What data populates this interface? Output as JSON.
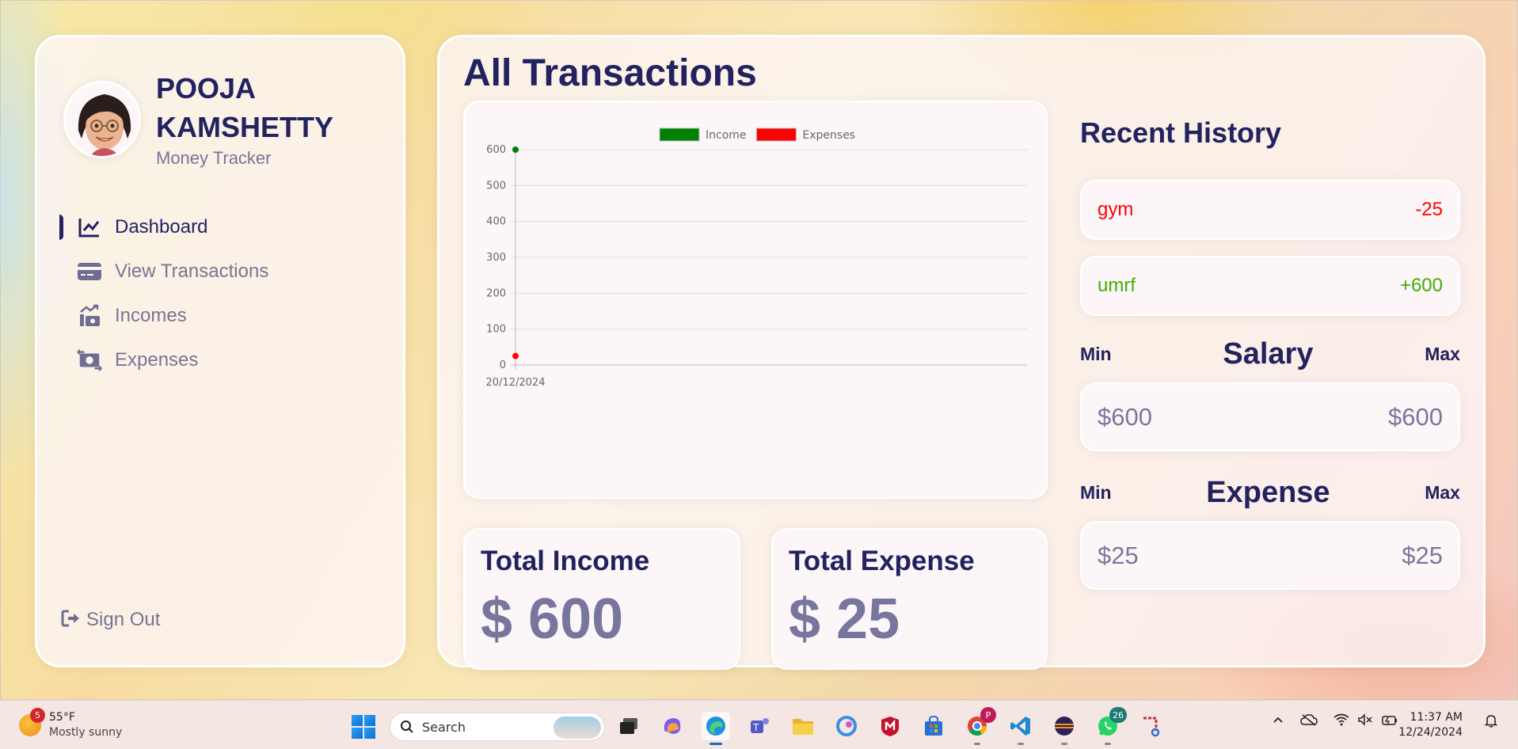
{
  "user": {
    "name": "POOJA KAMSHETTY",
    "subtitle": "Money Tracker"
  },
  "menu": [
    {
      "label": "Dashboard",
      "icon": "chart-line-icon",
      "active": true
    },
    {
      "label": "View Transactions",
      "icon": "credit-card-icon",
      "active": false
    },
    {
      "label": "Incomes",
      "icon": "money-bill-trend-up-icon",
      "active": false
    },
    {
      "label": "Expenses",
      "icon": "money-bill-transfer-icon",
      "active": false
    }
  ],
  "signout": {
    "label": "Sign Out"
  },
  "main": {
    "title": "All Transactions",
    "total_income": {
      "label": "Total Income",
      "value": "$ 600"
    },
    "total_expense": {
      "label": "Total Expense",
      "value": "$ 25"
    }
  },
  "history": {
    "title": "Recent History",
    "items": [
      {
        "title": "gym",
        "amount": "-25",
        "color": "#ff0000"
      },
      {
        "title": "umrf",
        "amount": "+600",
        "color": "#42ad00"
      }
    ]
  },
  "salary": {
    "min_label": "Min",
    "title": "Salary",
    "max_label": "Max",
    "min_value": "$600",
    "max_value": "$600"
  },
  "expense_range": {
    "min_label": "Min",
    "title": "Expense",
    "max_label": "Max",
    "min_value": "$25",
    "max_value": "$25"
  },
  "chart_data": {
    "type": "line",
    "x": [
      "20/12/2024"
    ],
    "series": [
      {
        "name": "Income",
        "values": [
          600
        ],
        "color": "#008000"
      },
      {
        "name": "Expenses",
        "values": [
          25
        ],
        "color": "#ff0000"
      }
    ],
    "yticks": [
      0,
      100,
      200,
      300,
      400,
      500,
      600
    ],
    "ylim": [
      0,
      600
    ],
    "legend": "top",
    "grid": true
  },
  "taskbar": {
    "weather": {
      "temp": "55°F",
      "desc": "Mostly sunny",
      "badge": "5"
    },
    "search_placeholder": "Search",
    "whatsapp_badge": "26",
    "chrome_badge": "P",
    "time": "11:37 AM",
    "date": "12/24/2024"
  },
  "colors": {
    "primary": "#222260",
    "income": "#008000",
    "expense": "#ff0000"
  }
}
